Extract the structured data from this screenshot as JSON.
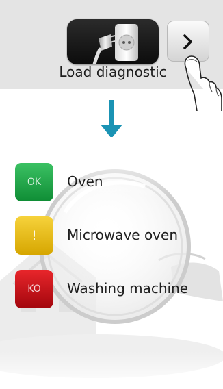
{
  "diagnostic": {
    "button_label": "Load diagnostic",
    "next_glyph": "›",
    "icon": "plug-and-socket-icon"
  },
  "legend": {
    "items": [
      {
        "badge": "OK",
        "label": "Oven",
        "color": "#1aa543"
      },
      {
        "badge": "!",
        "label": "Microwave oven",
        "color": "#e8bc10"
      },
      {
        "badge": "KO",
        "label": "Washing machine",
        "color": "#c7141b"
      }
    ]
  },
  "colors": {
    "arrow": "#1a93b4",
    "panel": "#e4e4e4"
  }
}
